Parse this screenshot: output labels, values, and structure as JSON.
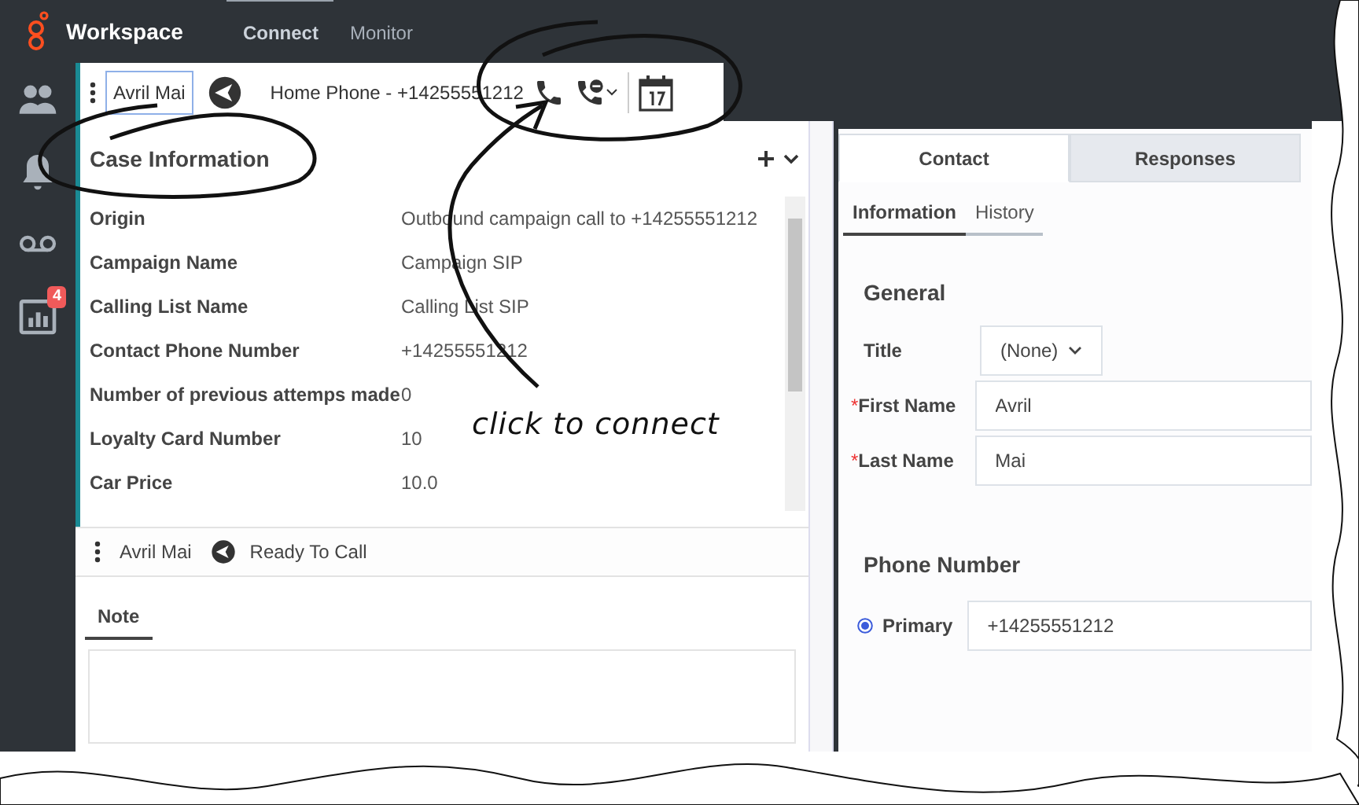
{
  "app": {
    "title": "Workspace",
    "nav": [
      {
        "label": "Connect",
        "selected": true
      },
      {
        "label": "Monitor",
        "selected": false
      }
    ]
  },
  "sidebar": {
    "items": [
      {
        "kind": "contacts"
      },
      {
        "kind": "alerts"
      },
      {
        "kind": "voicemail"
      },
      {
        "kind": "reports",
        "badge": "4"
      }
    ]
  },
  "interaction": {
    "contact": "Avril Mai",
    "phone": "Home Phone - +14255551212"
  },
  "case": {
    "title": "Case Information",
    "fields": [
      {
        "label": "Origin",
        "value": "Outbound campaign call to +14255551212"
      },
      {
        "label": "Campaign Name",
        "value": "Campaign SIP"
      },
      {
        "label": "Calling List Name",
        "value": "Calling List SIP"
      },
      {
        "label": "Contact Phone Number",
        "value": "+14255551212"
      },
      {
        "label": "Number of previous attemps made",
        "value": "0"
      },
      {
        "label": "Loyalty Card Number",
        "value": "10"
      },
      {
        "label": "Car Price",
        "value": "10.0"
      }
    ]
  },
  "party": {
    "name": "Avril Mai",
    "status": "Ready To Call"
  },
  "note_tabs": [
    {
      "label": "Note",
      "selected": true
    }
  ],
  "tabs": [
    {
      "label": "Contact",
      "selected": true
    },
    {
      "label": "Responses",
      "selected": false
    }
  ],
  "subtabs": [
    {
      "label": "Information",
      "selected": true
    },
    {
      "label": "History",
      "selected": false
    }
  ],
  "general": {
    "heading": "General",
    "fields": [
      {
        "kind": "select",
        "label": "Title",
        "value": "(None)"
      },
      {
        "kind": "text",
        "label": "First Name",
        "value": "Avril",
        "marker": "*"
      },
      {
        "kind": "text",
        "label": "Last Name",
        "value": "Mai",
        "marker": "*"
      }
    ]
  },
  "phone": {
    "heading": "Phone Number",
    "rows": [
      {
        "label": "Primary",
        "value": "+14255551212",
        "selected": true
      }
    ]
  },
  "annotation": {
    "text": "click to connect"
  }
}
